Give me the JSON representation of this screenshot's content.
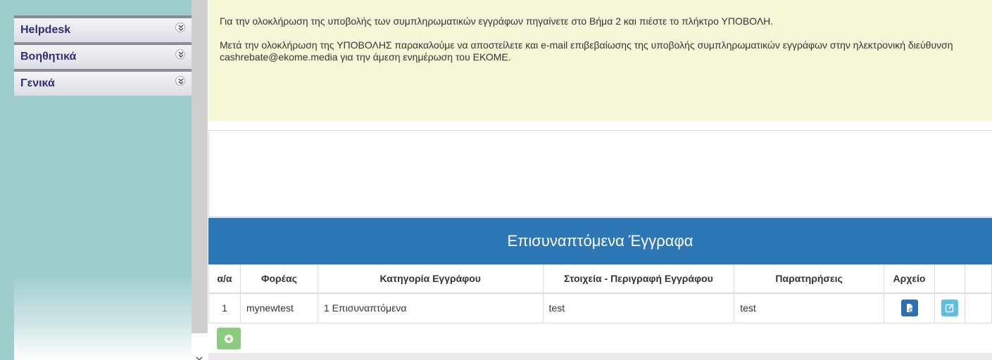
{
  "sidebar": {
    "items": [
      {
        "label": "Helpdesk",
        "icon": "chevron-double-down-icon"
      },
      {
        "label": "Βοηθητικά",
        "icon": "chevron-double-down-icon"
      },
      {
        "label": "Γενικά",
        "icon": "chevron-double-down-icon"
      }
    ]
  },
  "info": {
    "paragraph_1": "Για την ολοκλήρωση της υποβολής των συμπληρωματικών εγγράφων πηγαίνετε στο Βήμα 2 και πιέστε το πλήκτρο ΥΠΟΒΟΛΗ.",
    "paragraph_2": "Μετά την ολοκλήρωση της ΥΠΟΒΟΛΗΣ παρακαλούμε να αποστείλετε και e-mail επιβεβαίωσης της υποβολής συμπληρωματικών εγγράφων στην ηλεκτρονική διεύθυνση cashrebate@ekome.media για την άμεση ενημέρωση του ΕΚΟΜΕ."
  },
  "attachments": {
    "title": "Επισυναπτόμενα Έγγραφα",
    "columns": [
      "α/α",
      "Φορέας",
      "Κατηγορία Εγγράφου",
      "Στοιχεία - Περιγραφή Εγγράφου",
      "Παρατηρήσεις",
      "Αρχείο"
    ],
    "rows": [
      {
        "aa": "1",
        "foreas": "mynewtest",
        "category": "1 Επισυναπτόμενα",
        "description": "test",
        "remarks": "test",
        "file_icon": "file-icon",
        "edit_icon": "edit-icon"
      }
    ]
  },
  "colors": {
    "sidebar_bg": "#9ecdce",
    "info_bg": "#f6f7d7",
    "header_blue": "#2e77b6",
    "add_green": "#8ccc80",
    "edit_blue": "#5bc0de"
  },
  "add_button_icon": "plus-icon"
}
